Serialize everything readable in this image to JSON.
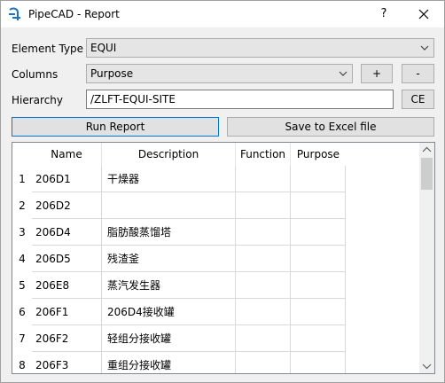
{
  "window": {
    "title": "PipeCAD - Report",
    "help_label": "?"
  },
  "form": {
    "element_type_label": "Element Type",
    "element_type_value": "EQUI",
    "columns_label": "Columns",
    "columns_value": "Purpose",
    "add_label": "+",
    "remove_label": "-",
    "hierarchy_label": "Hierarchy",
    "hierarchy_value": "/ZLFT-EQUI-SITE",
    "ce_label": "CE",
    "run_report_label": "Run Report",
    "save_excel_label": "Save to Excel file"
  },
  "table": {
    "headers": [
      "Name",
      "Description",
      "Function",
      "Purpose"
    ],
    "rows": [
      {
        "num": "1",
        "name": "206D1",
        "description": "干燥器",
        "function": "",
        "purpose": ""
      },
      {
        "num": "2",
        "name": "206D2",
        "description": "",
        "function": "",
        "purpose": ""
      },
      {
        "num": "3",
        "name": "206D4",
        "description": "脂肪酸蒸馏塔",
        "function": "",
        "purpose": ""
      },
      {
        "num": "4",
        "name": "206D5",
        "description": "残渣釜",
        "function": "",
        "purpose": ""
      },
      {
        "num": "5",
        "name": "206E8",
        "description": "蒸汽发生器",
        "function": "",
        "purpose": ""
      },
      {
        "num": "6",
        "name": "206F1",
        "description": "206D4接收罐",
        "function": "",
        "purpose": ""
      },
      {
        "num": "7",
        "name": "206F2",
        "description": "轻组分接收罐",
        "function": "",
        "purpose": ""
      },
      {
        "num": "8",
        "name": "206F3",
        "description": "重组分接收罐",
        "function": "",
        "purpose": ""
      }
    ]
  },
  "colors": {
    "accent": "#0078d7",
    "window_bg": "#f0f0f0"
  }
}
